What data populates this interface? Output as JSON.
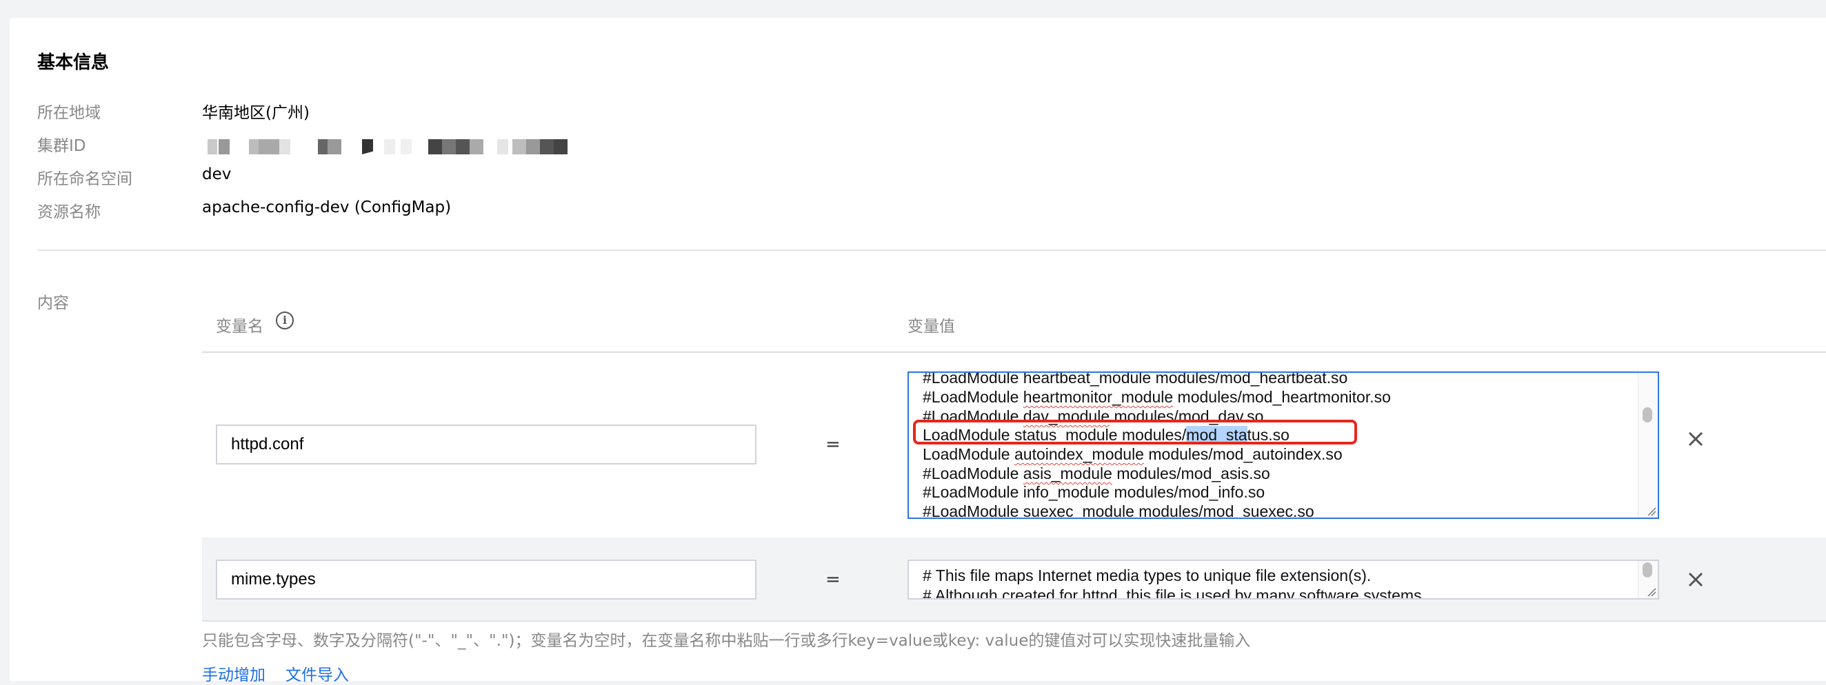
{
  "basic_info": {
    "title": "基本信息",
    "region_label": "所在地域",
    "region_value": "华南地区(广州)",
    "cluster_label": "集群ID",
    "namespace_label": "所在命名空间",
    "namespace_value": "dev",
    "resource_label": "资源名称",
    "resource_value": "apache-config-dev (ConfigMap)"
  },
  "content": {
    "label": "内容",
    "col_key_header": "变量名",
    "col_value_header": "变量值",
    "equals": "=",
    "rows": [
      {
        "key": "httpd.conf",
        "lines": [
          "#LoadModule heartbeat_module modules/mod_heartbeat.so",
          "#LoadModule heartmonitor_module modules/mod_heartmonitor.so",
          "#LoadModule dav_module modules/mod_dav.so",
          "LoadModule status_module modules/mod_status.so",
          "LoadModule autoindex_module modules/mod_autoindex.so",
          "#LoadModule asis_module modules/mod_asis.so",
          "#LoadModule info_module modules/mod_info.so",
          "#LoadModule suexec_module modules/mod_suexec.so"
        ],
        "highlight": {
          "before": "LoadModule status_module modules/",
          "selected": "mod_sta",
          "after": "tus.so"
        }
      },
      {
        "key": "mime.types",
        "lines": [
          "# This file maps Internet media types to unique file extension(s).",
          "# Although created for httpd, this file is used by many software systems"
        ]
      }
    ],
    "help_text": "只能包含字母、数字及分隔符(\"-\"、\"_\"、\".\")；变量名为空时，在变量名称中粘贴一行或多行key=value或key: value的键值对可以实现快速批量输入",
    "add_manual_label": "手动增加",
    "import_file_label": "文件导入"
  },
  "icons": {
    "key_info": "info-circle-icon",
    "remove": "close-icon",
    "resize": "resize-grip-icon"
  },
  "colors": {
    "link": "#1f6fe5",
    "focus_border": "#2e74e6",
    "highlight_box": "#e8261c",
    "selection": "#b3d4fc",
    "label_gray": "#888888"
  }
}
